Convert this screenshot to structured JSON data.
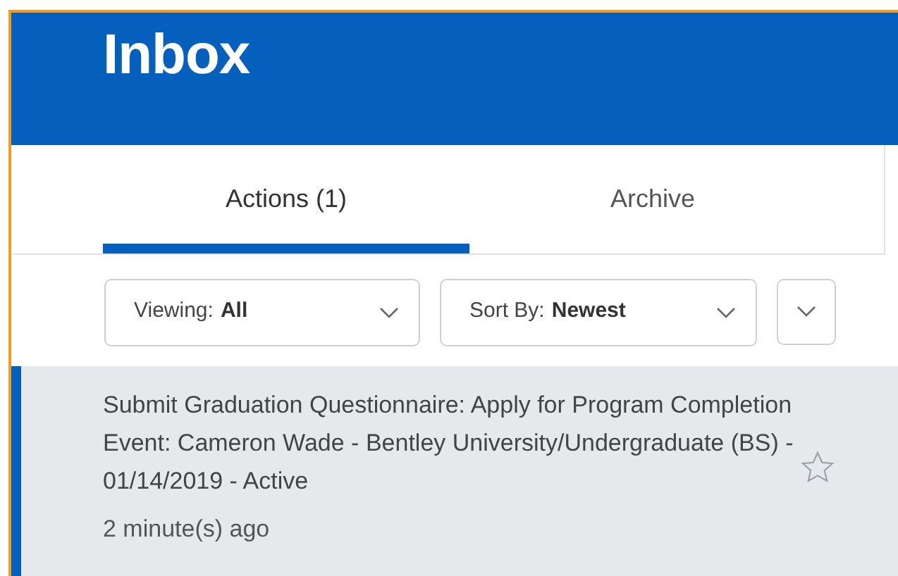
{
  "header": {
    "title": "Inbox"
  },
  "tabs": [
    {
      "label": "Actions (1)",
      "selected": true
    },
    {
      "label": "Archive",
      "selected": false
    }
  ],
  "filters": [
    {
      "kind": "dropdown",
      "label": "Viewing:",
      "value": "All"
    },
    {
      "kind": "dropdown",
      "label": "Sort By:",
      "value": "Newest"
    },
    {
      "kind": "toggle"
    }
  ],
  "items": [
    {
      "title": "Submit Graduation Questionnaire: Apply for Program Completion Event: Cameron Wade - Bentley University/Undergraduate (BS) - 01/14/2019 - Active",
      "time": "2 minute(s) ago",
      "selected": true,
      "starred": false
    }
  ]
}
